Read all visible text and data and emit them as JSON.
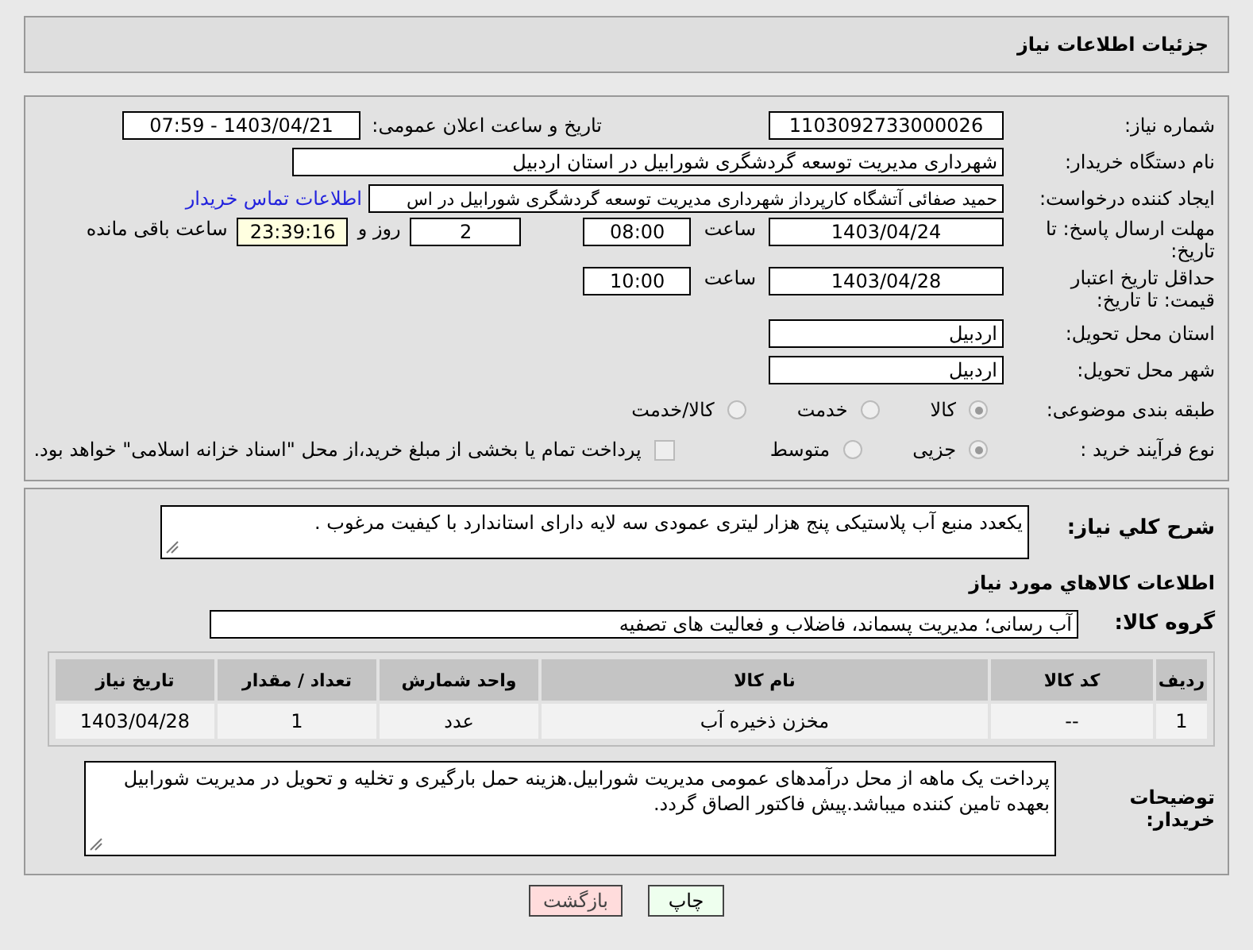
{
  "header": {
    "title": "جزئیات اطلاعات نیاز"
  },
  "need_number": {
    "label": "شماره نیاز:",
    "value": "1103092733000026"
  },
  "announce": {
    "label": "تاریخ و ساعت اعلان عمومی:",
    "value": "1403/04/21 - 07:59"
  },
  "buyer_org": {
    "label": "نام دستگاه خریدار:",
    "value": "شهرداری مدیریت توسعه گردشگری شورابیل در استان اردبیل"
  },
  "requester": {
    "label": "ایجاد کننده درخواست:",
    "value": "حمید صفائی آتشگاه کارپرداز شهرداری مدیریت توسعه گردشگری شورابیل در اس",
    "link": "اطلاعات تماس خریدار"
  },
  "reply_deadline": {
    "label": "مهلت ارسال پاسخ: تا تاریخ:",
    "date": "1403/04/24",
    "time_label": "ساعت",
    "time": "08:00",
    "days": "2",
    "days_label": "روز و",
    "remaining": "23:39:16",
    "remaining_label": "ساعت باقی مانده"
  },
  "price_validity": {
    "label": "حداقل تاریخ اعتبار قیمت: تا تاریخ:",
    "date": "1403/04/28",
    "time_label": "ساعت",
    "time": "10:00"
  },
  "delivery_province": {
    "label": "استان محل تحویل:",
    "value": "اردبیل"
  },
  "delivery_city": {
    "label": "شهر محل تحویل:",
    "value": "اردبیل"
  },
  "category": {
    "label": "طبقه بندی موضوعی:",
    "options": [
      {
        "label": "کالا",
        "selected": true
      },
      {
        "label": "خدمت",
        "selected": false
      },
      {
        "label": "کالا/خدمت",
        "selected": false
      }
    ]
  },
  "purchase_type": {
    "label": "نوع فرآیند خرید :",
    "options": [
      {
        "label": "جزیی",
        "selected": true
      },
      {
        "label": "متوسط",
        "selected": false
      }
    ],
    "payment_note": {
      "checked": false,
      "text": "پرداخت تمام یا بخشی از مبلغ خرید،از محل \"اسناد خزانه اسلامی\" خواهد بود."
    }
  },
  "description": {
    "label": "شرح كلي نياز:",
    "value": "یکعدد منبع آب پلاستیکی پنج هزار لیتری عمودی سه لایه دارای استاندارد با کیفیت مرغوب ."
  },
  "goods_heading": "اطلاعات كالاهاي مورد نياز",
  "goods_group": {
    "label": "گروه کالا:",
    "value": "آب رسانی؛ مدیریت پسماند، فاضلاب و فعالیت های تصفیه"
  },
  "table": {
    "columns": [
      "ردیف",
      "کد کالا",
      "نام کالا",
      "واحد شمارش",
      "تعداد / مقدار",
      "تاریخ نیاز"
    ],
    "rows": [
      [
        "1",
        "--",
        "مخزن ذخیره آب",
        "عدد",
        "1",
        "1403/04/28"
      ]
    ]
  },
  "buyer_notes": {
    "label": "توضیحات خریدار:",
    "value": "پرداخت یک ماهه از محل درآمدهای عمومی مدیریت شورابیل.هزینه حمل بارگیری و تخلیه و تحویل در مدیریت شورابیل بعهده تامین کننده میباشد.پیش فاکتور الصاق گردد."
  },
  "buttons": [
    {
      "label": "چاپ",
      "kind": "print"
    },
    {
      "label": "بازگشت",
      "kind": "back"
    }
  ]
}
